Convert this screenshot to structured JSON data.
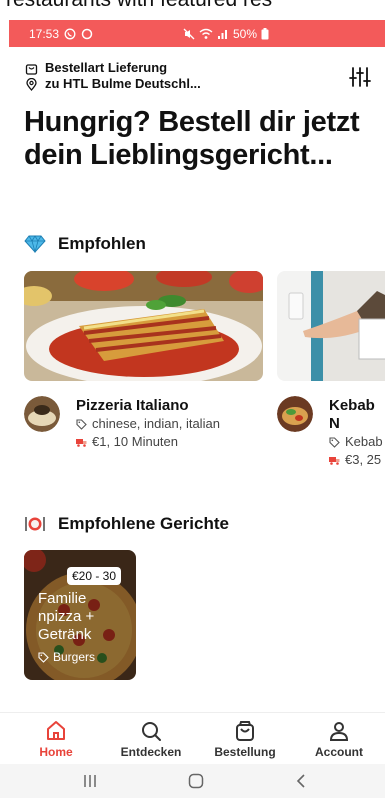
{
  "top_cut_text": "restaurants with featured res",
  "status_bar": {
    "time": "17:53",
    "battery": "50%"
  },
  "header": {
    "delivery_mode": "Bestellart Lieferung",
    "address": "zu HTL Bulme Deutschl..."
  },
  "headline": "Hungrig? Bestell dir jetzt dein Lieblingsgericht...",
  "recommended": {
    "title": "Empfohlen",
    "restaurants": [
      {
        "name": "Pizzeria Italiano",
        "tags": "chinese, indian, italian",
        "delivery": "€1, 10 Minuten"
      },
      {
        "name": "Kebab N",
        "tags": "Kebab",
        "delivery": "€3, 25"
      }
    ]
  },
  "dishes": {
    "title": "Empfohlene Gerichte",
    "items": [
      {
        "price": "€20 - 30",
        "name": "Familie npizza + Getränk",
        "category": "Burgers"
      }
    ]
  },
  "bottom_nav": [
    {
      "label": "Home",
      "active": true
    },
    {
      "label": "Entdecken",
      "active": false
    },
    {
      "label": "Bestellung",
      "active": false
    },
    {
      "label": "Account",
      "active": false
    }
  ],
  "colors": {
    "accent": "#e8433a",
    "status_bar": "#f35a5a"
  }
}
